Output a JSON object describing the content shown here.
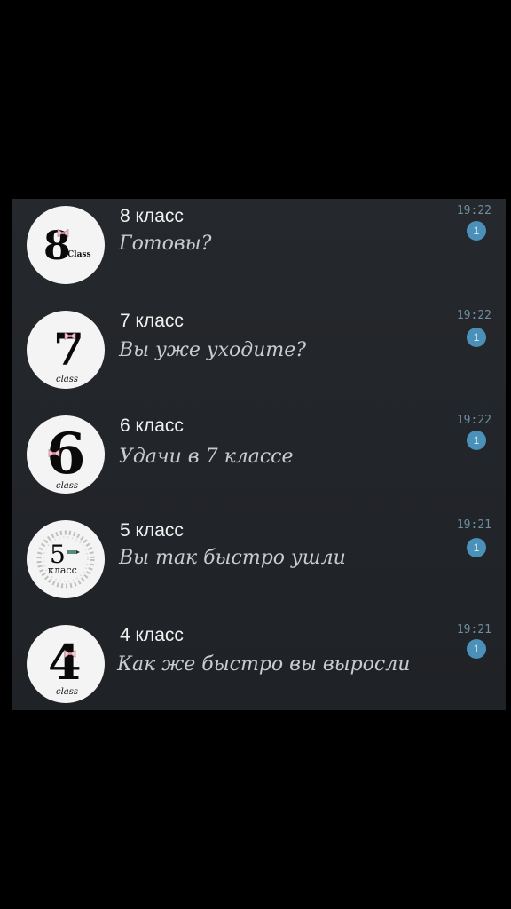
{
  "chats": [
    {
      "title": "8 класс",
      "message": "Готовы?",
      "time": "19:22",
      "unread": "1",
      "avatar_digit": "8",
      "avatar_sub": "Class",
      "avatar_icon": "number-8-avatar-icon"
    },
    {
      "title": "7 класс",
      "message": "Вы уже уходите?",
      "time": "19:22",
      "unread": "1",
      "avatar_digit": "7",
      "avatar_sub": "class",
      "avatar_icon": "number-7-avatar-icon"
    },
    {
      "title": "6 класс",
      "message": "Удачи в  7 классе",
      "time": "19:22",
      "unread": "1",
      "avatar_digit": "6",
      "avatar_sub": "class",
      "avatar_icon": "number-6-avatar-icon"
    },
    {
      "title": "5 класс",
      "message": "Вы так быстро ушли",
      "time": "19:21",
      "unread": "1",
      "avatar_digit": "5",
      "avatar_sub": "класс",
      "avatar_icon": "number-5-avatar-icon"
    },
    {
      "title": "4 класс",
      "message": "Как же быстро вы выросли",
      "time": "19:21",
      "unread": "1",
      "avatar_digit": "4",
      "avatar_sub": "class",
      "avatar_icon": "number-4-avatar-icon"
    }
  ],
  "colors": {
    "background": "#000000",
    "panel": "#25282c",
    "badge": "#4a90b8",
    "time": "#6f8fa0",
    "bow": "#f4c4cf"
  }
}
